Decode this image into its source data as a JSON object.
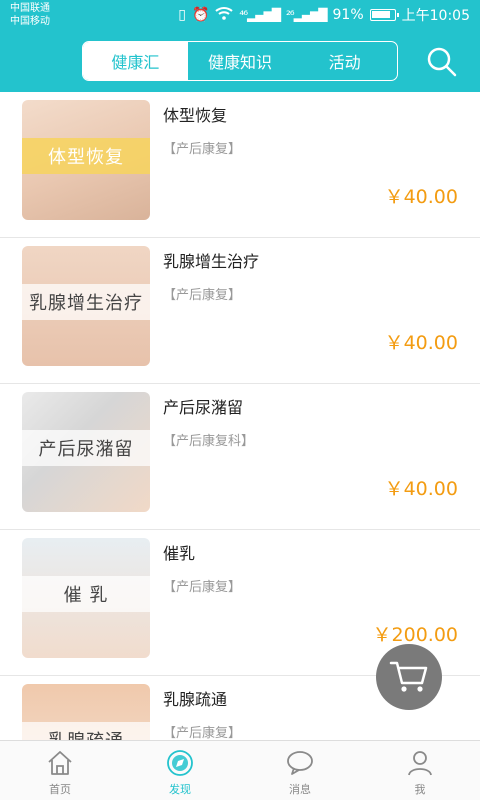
{
  "status_bar": {
    "carrier1": "中国联通",
    "carrier2": "中国移动",
    "signal1": "⁴⁶",
    "signal2": "²⁶",
    "battery": "91%",
    "time": "上午10:05"
  },
  "header": {
    "tabs": [
      {
        "label": "健康汇",
        "active": true
      },
      {
        "label": "健康知识",
        "active": false
      },
      {
        "label": "活动",
        "active": false
      }
    ],
    "icon": "search-icon"
  },
  "items": [
    {
      "thumb_text": "体型恢复",
      "title": "体型恢复",
      "tag": "【产后康复】",
      "price": "￥40.00"
    },
    {
      "thumb_text": "乳腺增生治疗",
      "title": "乳腺增生治疗",
      "tag": "【产后康复】",
      "price": "￥40.00"
    },
    {
      "thumb_text": "产后尿潴留",
      "title": "产后尿潴留",
      "tag": "【产后康复科】",
      "price": "￥40.00"
    },
    {
      "thumb_text": "催 乳",
      "title": "催乳",
      "tag": "【产后康复】",
      "price": "￥200.00"
    },
    {
      "thumb_text": "乳腺疏通",
      "title": "乳腺疏通",
      "tag": "【产后康复】",
      "price": ""
    }
  ],
  "cart": {
    "icon": "cart-icon"
  },
  "bottom_nav": [
    {
      "label": "首页",
      "icon": "home-icon",
      "active": false
    },
    {
      "label": "发现",
      "icon": "discover-icon",
      "active": true
    },
    {
      "label": "消息",
      "icon": "message-icon",
      "active": false
    },
    {
      "label": "我",
      "icon": "user-icon",
      "active": false
    }
  ],
  "colors": {
    "accent": "#23c3cd",
    "price": "#f39c12",
    "tag": "#999999"
  }
}
